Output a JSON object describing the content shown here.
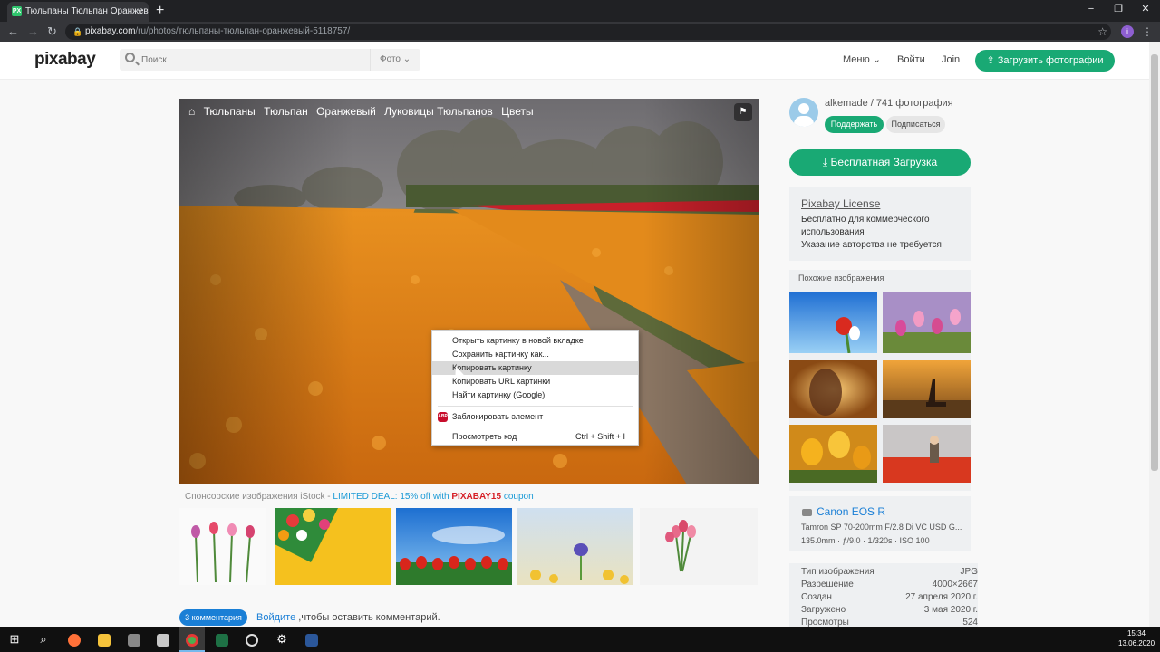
{
  "browser": {
    "tab_title": "Тюльпаны Тюльпан Оранжевый",
    "tab_favicon": "PX",
    "tab_close": "×",
    "new_tab": "+",
    "url_host": "pixabay.com",
    "url_path": "/ru/photos/тюльпаны-тюльпан-оранжевый-5118757/",
    "profile_initial": "i",
    "win_min": "−",
    "win_max": "❐",
    "win_close": "✕",
    "back": "←",
    "forward": "→",
    "reload": "↻"
  },
  "header": {
    "logo": "pixabay",
    "search_placeholder": "Поиск",
    "search_type": "Фото",
    "menu": "Меню",
    "login": "Войти",
    "join": "Join",
    "upload": "Загрузить фотографии"
  },
  "photo": {
    "tags": [
      "Тюльпаны",
      "Тюльпан",
      "Оранжевый",
      "Луковицы Тюльпанов",
      "Цветы"
    ]
  },
  "context_menu": {
    "items": [
      "Открыть картинку в новой вкладке",
      "Сохранить картинку как...",
      "Копировать картинку",
      "Копировать URL картинки",
      "Найти картинку (Google)",
      "Заблокировать элемент",
      "Просмотреть код"
    ],
    "shortcut": "Ctrl + Shift + I",
    "abp_label": "ABP",
    "highlighted_index": 2
  },
  "sponsored": {
    "prefix": "Спонсорские изображения iStock - ",
    "deal": "LIMITED DEAL: 15% off with ",
    "code": "PIXABAY15",
    "suffix": " coupon"
  },
  "comments": {
    "button": "3 комментария",
    "login_link": "Войдите",
    "text": " ,чтобы оставить комментарий."
  },
  "author": {
    "name": "alkemade / 741 фотография",
    "support": "Поддержать",
    "subscribe": "Подписаться"
  },
  "download": {
    "label": "Бесплатная Загрузка"
  },
  "license": {
    "title": "Pixabay License",
    "lines": [
      "Бесплатно для коммерческого",
      "использования",
      "Указание авторства не требуется"
    ]
  },
  "similar": {
    "title": "Похожие изображения"
  },
  "camera": {
    "model": "Canon EOS R",
    "lens": "Tamron SP 70-200mm F/2.8 Di VC USD G...",
    "settings": "135.0mm · ƒ/9.0 · 1/320s · ISO 100"
  },
  "info": {
    "rows": [
      {
        "label": "Тип изображения",
        "value": "JPG"
      },
      {
        "label": "Разрешение",
        "value": "4000×2667"
      },
      {
        "label": "Создан",
        "value": "27 апреля 2020 г."
      },
      {
        "label": "Загружено",
        "value": "3 мая 2020 г."
      },
      {
        "label": "Просмотры",
        "value": "524"
      }
    ]
  },
  "taskbar": {
    "time": "15:34",
    "date": "13.06.2020"
  },
  "colors": {
    "brand_green": "#19a974",
    "link_blue": "#1a7fd6",
    "coupon_red": "#d61f26"
  }
}
